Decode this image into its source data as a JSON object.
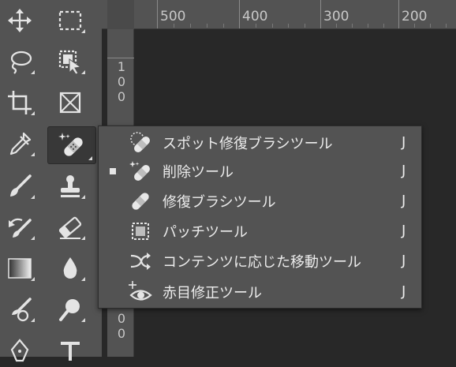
{
  "toolbar": {
    "tools": [
      {
        "name": "move-tool"
      },
      {
        "name": "rectangular-marquee-tool"
      },
      {
        "name": "lasso-tool"
      },
      {
        "name": "object-selection-tool"
      },
      {
        "name": "crop-tool"
      },
      {
        "name": "frame-tool"
      },
      {
        "name": "eyedropper-tool"
      },
      {
        "name": "spot-healing-brush-tool",
        "active": true
      },
      {
        "name": "brush-tool"
      },
      {
        "name": "clone-stamp-tool"
      },
      {
        "name": "history-brush-tool"
      },
      {
        "name": "eraser-tool"
      },
      {
        "name": "gradient-tool"
      },
      {
        "name": "blur-tool"
      },
      {
        "name": "dodge-tool"
      },
      {
        "name": "pen-tool"
      },
      {
        "name": "type-tool"
      }
    ]
  },
  "ruler": {
    "horizontal_labels": [
      "500",
      "400",
      "300",
      "200"
    ],
    "vertical_label_top": [
      "1",
      "0",
      "0"
    ],
    "vertical_label_bottom": [
      "0",
      "0"
    ]
  },
  "flyout": {
    "items": [
      {
        "label": "スポット修復ブラシツール",
        "shortcut": "J",
        "icon": "spot-healing-brush-icon",
        "selected": false
      },
      {
        "label": "削除ツール",
        "shortcut": "J",
        "icon": "remove-tool-icon",
        "selected": true
      },
      {
        "label": "修復ブラシツール",
        "shortcut": "J",
        "icon": "healing-brush-icon",
        "selected": false
      },
      {
        "label": "パッチツール",
        "shortcut": "J",
        "icon": "patch-tool-icon",
        "selected": false
      },
      {
        "label": "コンテンツに応じた移動ツール",
        "shortcut": "J",
        "icon": "content-aware-move-icon",
        "selected": false
      },
      {
        "label": "赤目修正ツール",
        "shortcut": "J",
        "icon": "red-eye-icon",
        "selected": false
      }
    ]
  },
  "colors": {
    "panel": "#535353",
    "canvas": "#282828",
    "text": "#ececec"
  }
}
